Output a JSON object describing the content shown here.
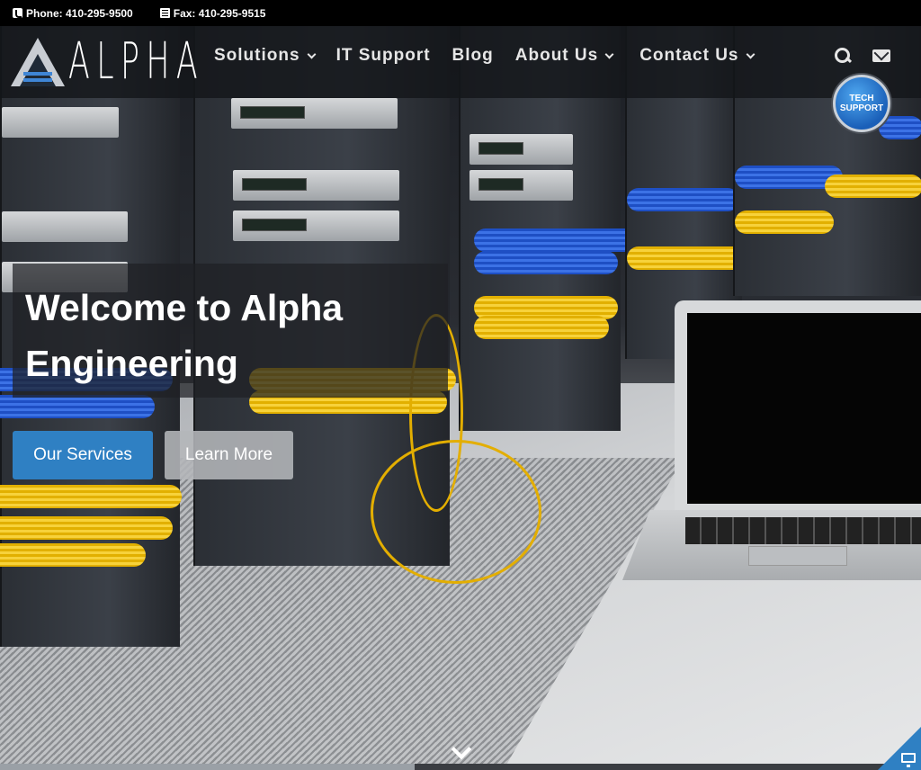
{
  "topbar": {
    "phone": "Phone: 410-295-9500",
    "fax": "Fax: 410-295-9515"
  },
  "header": {
    "logo_text": "ALPHA",
    "menu": [
      {
        "label": "Solutions",
        "dropdown": true
      },
      {
        "label": "IT Support",
        "dropdown": false
      },
      {
        "label": "Blog",
        "dropdown": false
      },
      {
        "label": "About Us",
        "dropdown": true
      },
      {
        "label": "Contact Us",
        "dropdown": true
      }
    ],
    "tech_support": {
      "line1": "TECH",
      "line2": "SUPPORT"
    }
  },
  "hero": {
    "title_line1": "Welcome to Alpha",
    "title_line2": "Engineering",
    "primary_button": "Our Services",
    "secondary_button": "Learn More",
    "slide_progress_percent": 45
  },
  "colors": {
    "accent": "#2f80c3",
    "badge": "#1a5fb8"
  },
  "icons": [
    "phone-icon",
    "fax-icon",
    "search-icon",
    "mail-icon",
    "chevron-down-icon",
    "monitor-icon"
  ]
}
